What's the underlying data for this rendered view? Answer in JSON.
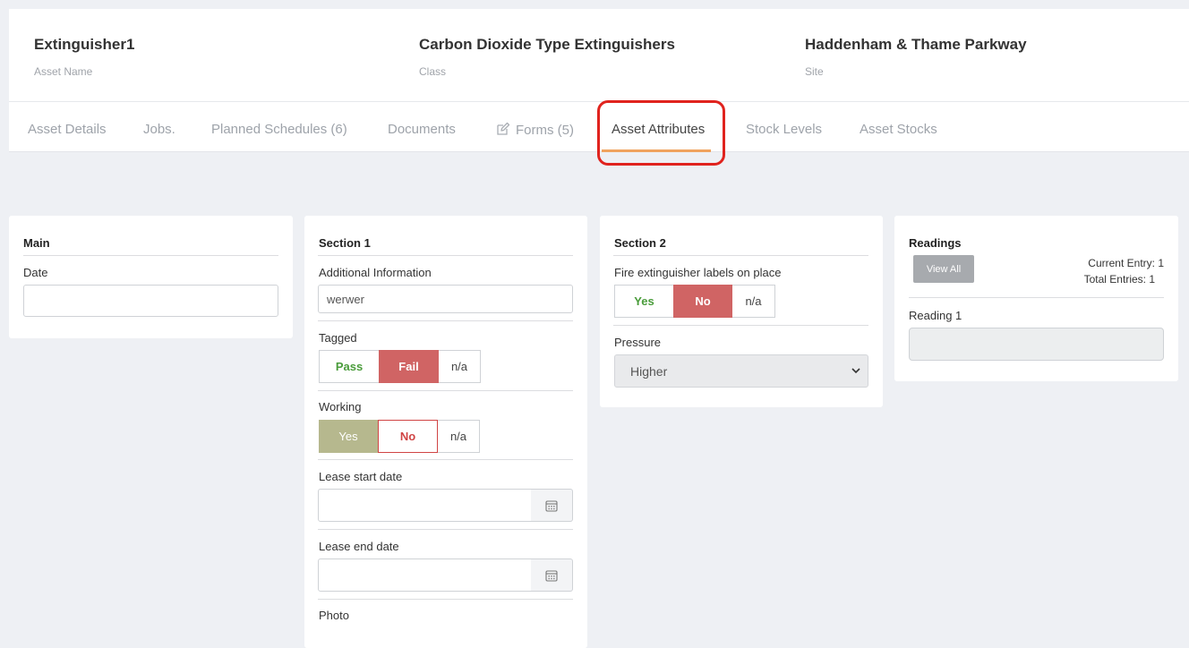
{
  "header": {
    "asset_name": {
      "value": "Extinguisher1",
      "label": "Asset Name"
    },
    "class": {
      "value": "Carbon Dioxide Type Extinguishers",
      "label": "Class"
    },
    "site": {
      "value": "Haddenham & Thame Parkway",
      "label": "Site"
    }
  },
  "tabs": {
    "asset_details": "Asset Details",
    "jobs": "Jobs.",
    "planned_schedules": "Planned Schedules (6)",
    "documents": "Documents",
    "forms": "Forms (5)",
    "asset_attributes": "Asset Attributes",
    "stock_levels": "Stock Levels",
    "asset_stocks": "Asset Stocks",
    "active": "Asset Attributes"
  },
  "main_card": {
    "title": "Main",
    "date_label": "Date",
    "date_value": ""
  },
  "section1": {
    "title": "Section 1",
    "additional_info_label": "Additional Information",
    "additional_info_value": "werwer",
    "tagged": {
      "label": "Tagged",
      "options": [
        "Pass",
        "Fail",
        "n/a"
      ],
      "selected": "Fail"
    },
    "working": {
      "label": "Working",
      "options": [
        "Yes",
        "No",
        "n/a"
      ],
      "selected": "Yes"
    },
    "lease_start_label": "Lease start date",
    "lease_start_value": "",
    "lease_end_label": "Lease end date",
    "lease_end_value": "",
    "photo_label": "Photo"
  },
  "section2": {
    "title": "Section 2",
    "labels_on_place": {
      "label": "Fire extinguisher labels on place",
      "options": [
        "Yes",
        "No",
        "n/a"
      ],
      "selected": "No"
    },
    "pressure": {
      "label": "Pressure",
      "selected": "Higher"
    }
  },
  "readings": {
    "title": "Readings",
    "view_all": "View All",
    "current_entry": "Current Entry: 1",
    "total_entries": "Total Entries: 1",
    "reading1_label": "Reading 1",
    "reading1_value": ""
  },
  "colors": {
    "accent_underline": "#f0a35e",
    "highlight_ring": "#e0231e",
    "yes_pass_text": "#4a9c3b",
    "no_fail_selected_bg": "#d06464",
    "working_yes_selected_bg": "#b6b88e",
    "no_unselected_text": "#d04444"
  },
  "icons": [
    "edit-icon",
    "calendar-icon",
    "chevron-down-icon"
  ]
}
